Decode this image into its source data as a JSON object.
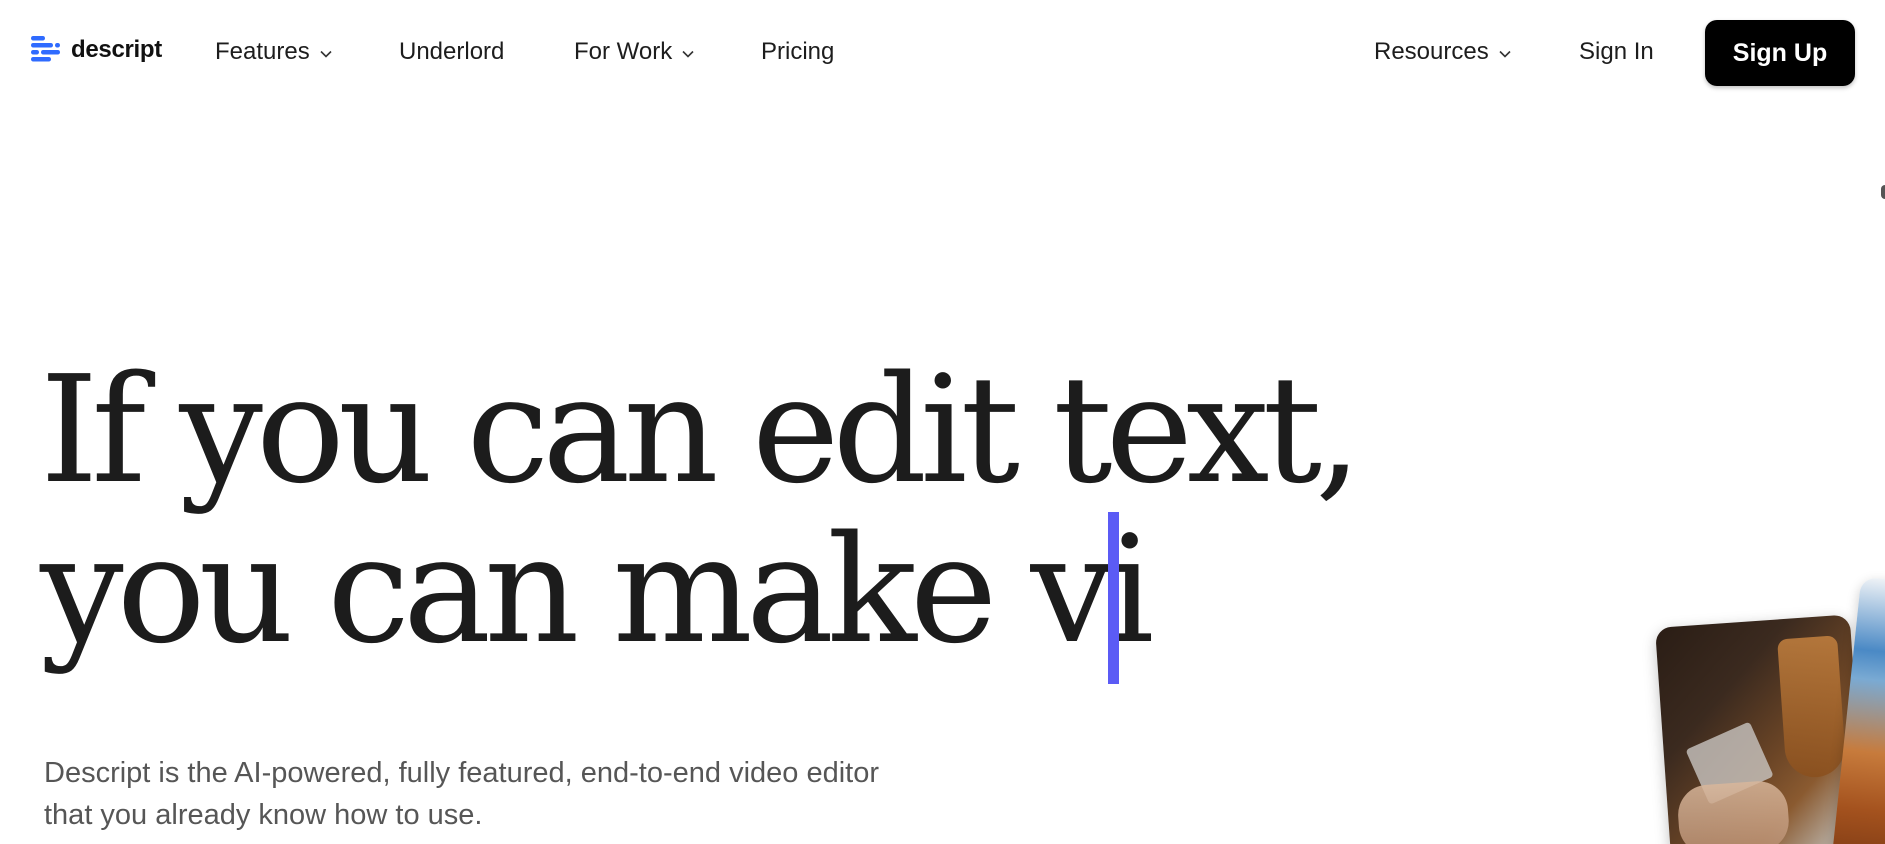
{
  "brand": {
    "name": "descript",
    "accent": "#2f6bff"
  },
  "nav": {
    "features": "Features",
    "underlord": "Underlord",
    "for_work": "For Work",
    "pricing": "Pricing",
    "resources": "Resources",
    "sign_in": "Sign In",
    "sign_up": "Sign Up"
  },
  "hero": {
    "headline_line1": "If you can edit text,",
    "headline_line2": "you can make vi",
    "subtext_line1": "Descript is the AI-powered, fully featured, end-to-end video editor",
    "subtext_line2": "that you already know how to use.",
    "caret_color": "#5b5bf5"
  },
  "icons": {
    "logo": "descript-logo-icon",
    "dropdown": "chevron-down-icon"
  }
}
